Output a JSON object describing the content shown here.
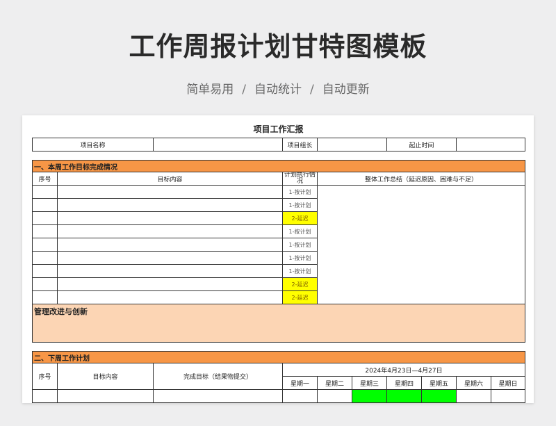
{
  "hero": {
    "title": "工作周报计划甘特图模板",
    "features": [
      "简单易用",
      "自动统计",
      "自动更新"
    ],
    "separator": "/"
  },
  "sheet": {
    "title": "项目工作汇报",
    "header": {
      "project_name_label": "项目名称",
      "project_name_value": "",
      "leader_label": "项目组长",
      "leader_value": "",
      "period_label": "起止时间",
      "period_value": ""
    },
    "section1": {
      "title": "一、本周工作目标完成情况",
      "columns": {
        "no": "序号",
        "content": "目标内容",
        "status": "计划执行情况",
        "summary": "整体工作总结（延迟原因、困难与不足）"
      },
      "rows": [
        {
          "status": "1-按计划",
          "delayed": false
        },
        {
          "status": "1-按计划",
          "delayed": false
        },
        {
          "status": "2-延迟",
          "delayed": true
        },
        {
          "status": "1-按计划",
          "delayed": false
        },
        {
          "status": "1-按计划",
          "delayed": false
        },
        {
          "status": "1-按计划",
          "delayed": false
        },
        {
          "status": "1-按计划",
          "delayed": false
        },
        {
          "status": "2-延迟",
          "delayed": true
        },
        {
          "status": "2-延迟",
          "delayed": true
        }
      ],
      "improvement_label": "管理改进与创新"
    },
    "section2": {
      "title": "二、下周工作计划",
      "columns": {
        "no": "序号",
        "content": "目标内容",
        "deliverable": "完成目标（结果物提交）",
        "date_range": "2024年4月23日—4月27日"
      },
      "weekdays": [
        "星期一",
        "星期二",
        "星期三",
        "星期四",
        "星期五",
        "星期六",
        "星期日"
      ],
      "active_days": [
        false,
        false,
        true,
        true,
        true,
        false,
        false
      ]
    },
    "colors": {
      "section_bg": "#f79646",
      "notes_bg": "#fcd5b4",
      "delayed_bg": "#ffff00",
      "gantt_bg": "#00ff00"
    }
  }
}
